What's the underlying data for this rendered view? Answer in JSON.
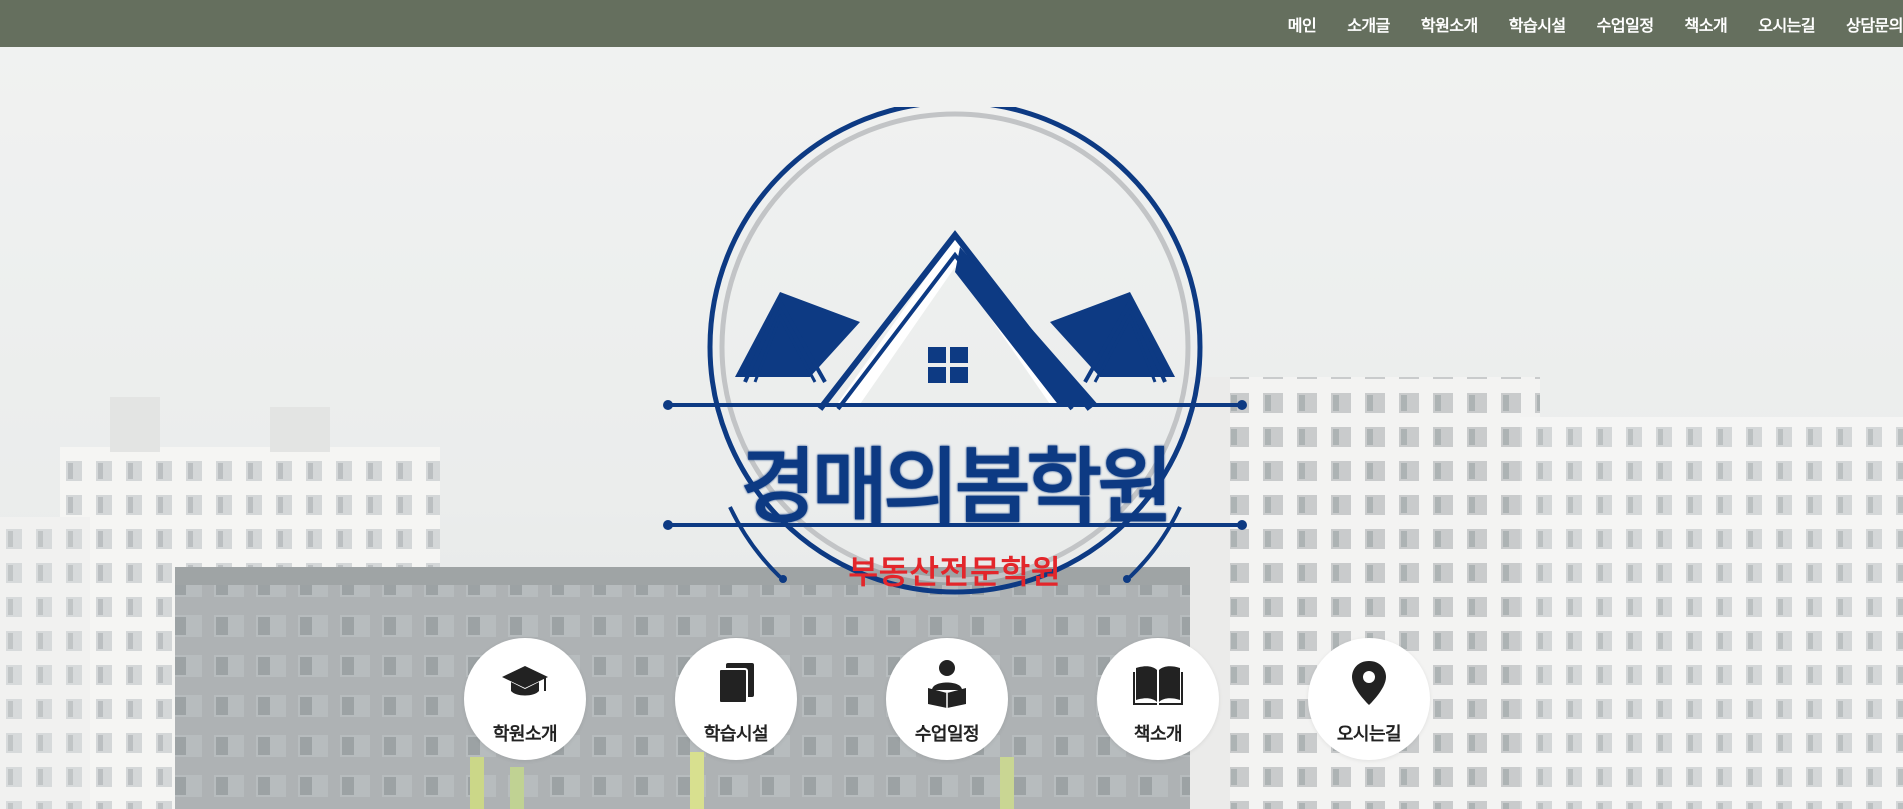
{
  "nav": {
    "items": [
      "메인",
      "소개글",
      "학원소개",
      "학습시설",
      "수업일정",
      "책소개",
      "오시는길",
      "상담문의"
    ]
  },
  "emblem": {
    "title": "경매의봄학원",
    "subtitle": "부동산전문학원"
  },
  "quick": [
    {
      "label": "학원소개",
      "icon": "graduation-cap-icon"
    },
    {
      "label": "학습시설",
      "icon": "copy-icon"
    },
    {
      "label": "수업일정",
      "icon": "reader-icon"
    },
    {
      "label": "책소개",
      "icon": "open-book-icon"
    },
    {
      "label": "오시는길",
      "icon": "map-pin-icon"
    }
  ],
  "colors": {
    "nav_bg": "#656f5e",
    "brand_blue": "#0d3a83",
    "brand_red": "#e3262b"
  }
}
